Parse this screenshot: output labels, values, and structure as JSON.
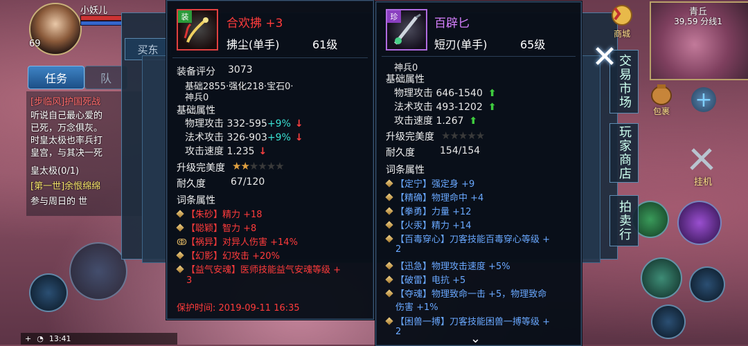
{
  "hud": {
    "player_name": "小妖儿",
    "level": "69",
    "tab_task": "任务",
    "tab_team": "队",
    "quest_lines": [
      "[步临风]护国死战",
      "听说自己最心爱的",
      "已死，万念俱灰。",
      "时皇太极也率兵打",
      "皇宫，与其决一死",
      "皇太极(0/1)",
      "[第一世]余恨绵绵",
      "参与周日的 世"
    ],
    "time": "13:41",
    "buy_tab": "买东"
  },
  "minimap": {
    "title": "青丘",
    "coords": "39,59 分线1"
  },
  "right_hud": {
    "shop_label": "商城",
    "bag_label": "包裹",
    "hang_label": "挂机",
    "side_tabs": [
      "交易市场",
      "玩家商店",
      "拍卖行"
    ]
  },
  "left_item": {
    "badge": "装",
    "name": "合欢拂 +3",
    "type": "拂尘(单手)",
    "level": "61级",
    "score_label": "装备评分",
    "score_value": "3073",
    "score_breakdown": "基础2855·强化218·宝石0·",
    "shenbing": "神兵0",
    "base_attr_title": "基础属性",
    "base_attrs": [
      {
        "label": "物理攻击 332-595",
        "pct": "+9%"
      },
      {
        "label": "法术攻击 326-903",
        "pct": "+9%"
      },
      {
        "label": "攻击速度 1.235",
        "pct": ""
      }
    ],
    "perfection_label": "升级完美度",
    "stars_filled": 2,
    "stars_total": 6,
    "durability_label": "耐久度",
    "durability_value": "67/120",
    "affix_title": "词条属性",
    "affixes": [
      "【朱砂】精力 +18",
      "【聪颖】智力 +8",
      "【祸异】对异人伤害 +14%",
      "【幻影】幻攻击 +20%",
      "【益气安魂】医师技能益气安魂等级 +",
      "3"
    ],
    "protect_time": "保护时间: 2019-09-11 16:35"
  },
  "right_item": {
    "badge": "珍",
    "name": "百辟匕",
    "type": "短刃(单手)",
    "level": "65级",
    "shenbing": "神兵0",
    "base_attr_title": "基础属性",
    "base_attrs": [
      "物理攻击 646-1540",
      "法术攻击 493-1202",
      "攻击速度 1.267"
    ],
    "perfection_label": "升级完美度",
    "stars_filled": 0,
    "stars_total": 5,
    "durability_label": "耐久度",
    "durability_value": "154/154",
    "affix_title": "词条属性",
    "affixes": [
      "【定宁】强定身 +9",
      "【精确】物理命中 +4",
      "【拳勇】力量 +12",
      "【火汞】精力 +14",
      "【百毒穿心】刀客技能百毒穿心等级 +",
      "2",
      "【迅急】物理攻击速度 +5%",
      "【破雷】电抗 +5",
      "【夺魂】物理致命一击 +5，物理致命",
      "伤害 +1%",
      "【困兽一搏】刀客技能困兽一搏等级 +",
      "2"
    ]
  },
  "colors": {
    "red_quality": "#ff3b3b",
    "purple_quality": "#d680ff",
    "affix_blue": "#69a8ff",
    "bonus_cyan": "#3ae0d2"
  }
}
